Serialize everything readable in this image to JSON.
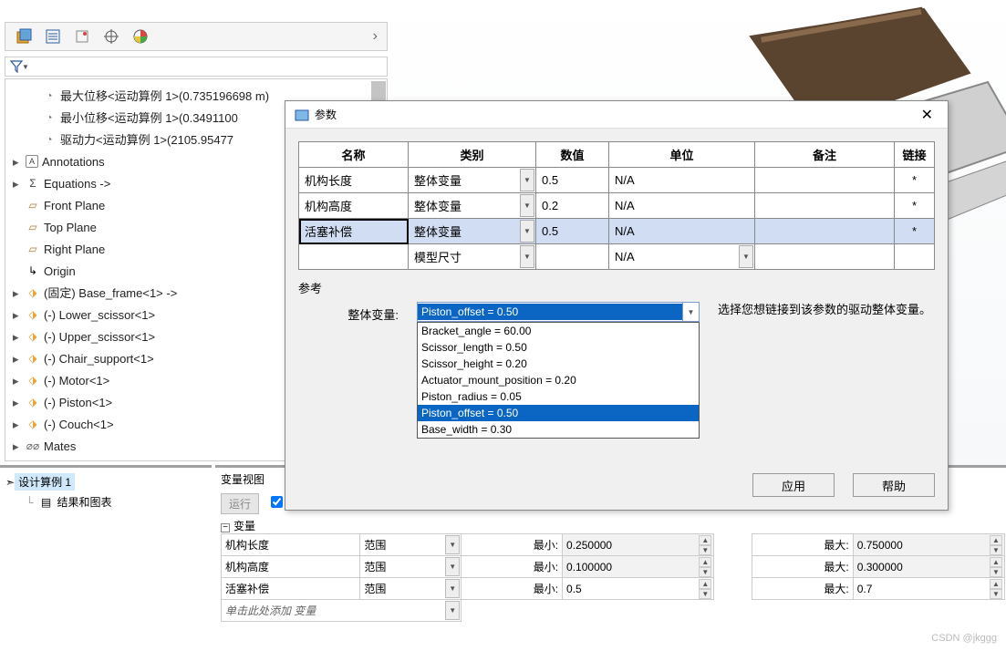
{
  "toolbar": {
    "arrow": "›"
  },
  "tree": {
    "sensors": [
      "最大位移<运动算例 1>(0.735196698 m)",
      "最小位移<运动算例 1>(0.3491100",
      "驱动力<运动算例 1>(2105.95477"
    ],
    "annotations": "Annotations",
    "equations": "Equations ->",
    "planes": [
      "Front Plane",
      "Top Plane",
      "Right Plane"
    ],
    "origin": "Origin",
    "parts": [
      "(固定) Base_frame<1> ->",
      "(-) Lower_scissor<1>",
      "(-) Upper_scissor<1>",
      "(-) Chair_support<1>",
      "(-) Motor<1>",
      "(-) Piston<1>",
      "(-) Couch<1>"
    ],
    "mates": "Mates"
  },
  "bottom_left": {
    "item1_prefix": "➣",
    "item1": "设计算例 1",
    "item2": "结果和图表"
  },
  "bottom_right": {
    "tab_label": "变量视图",
    "run_btn": "运行",
    "section": "变量",
    "rows": [
      {
        "name": "机构长度",
        "type": "范围",
        "min_l": "最小:",
        "min": "0.250000",
        "max_l": "最大:",
        "max": "0.750000"
      },
      {
        "name": "机构高度",
        "type": "范围",
        "min_l": "最小:",
        "min": "0.100000",
        "max_l": "最大:",
        "max": "0.300000"
      },
      {
        "name": "活塞补偿",
        "type": "范围",
        "min_l": "最小:",
        "min": "0.5",
        "max_l": "最大:",
        "max": "0.7"
      }
    ],
    "add_hint": "单击此处添加 变量"
  },
  "dialog": {
    "title": "参数",
    "headers": {
      "name": "名称",
      "category": "类别",
      "value": "数值",
      "unit": "单位",
      "remark": "备注",
      "link": "链接"
    },
    "rows": [
      {
        "name": "机构长度",
        "cat": "整体变量",
        "val": "0.5",
        "unit": "N/A",
        "link": "*"
      },
      {
        "name": "机构高度",
        "cat": "整体变量",
        "val": "0.2",
        "unit": "N/A",
        "link": "*"
      },
      {
        "name": "活塞补偿",
        "cat": "整体变量",
        "val": "0.5",
        "unit": "N/A",
        "link": "*",
        "selected": true,
        "name_focus": true
      },
      {
        "name": "",
        "cat": "模型尺寸",
        "val": "",
        "unit": "N/A",
        "link": ""
      }
    ],
    "ref_label": "参考",
    "combo_label": "整体变量:",
    "combo_selected": "Piston_offset = 0.50",
    "combo_options": [
      "Bracket_angle = 60.00",
      "Scissor_length = 0.50",
      "Scissor_height = 0.20",
      "Actuator_mount_position = 0.20",
      "Piston_radius = 0.05",
      "Piston_offset = 0.50",
      "Base_width = 0.30"
    ],
    "help_text": "选择您想链接到该参数的驱动整体变量。",
    "apply": "应用",
    "help": "帮助"
  },
  "watermark": "CSDN @jkggg"
}
